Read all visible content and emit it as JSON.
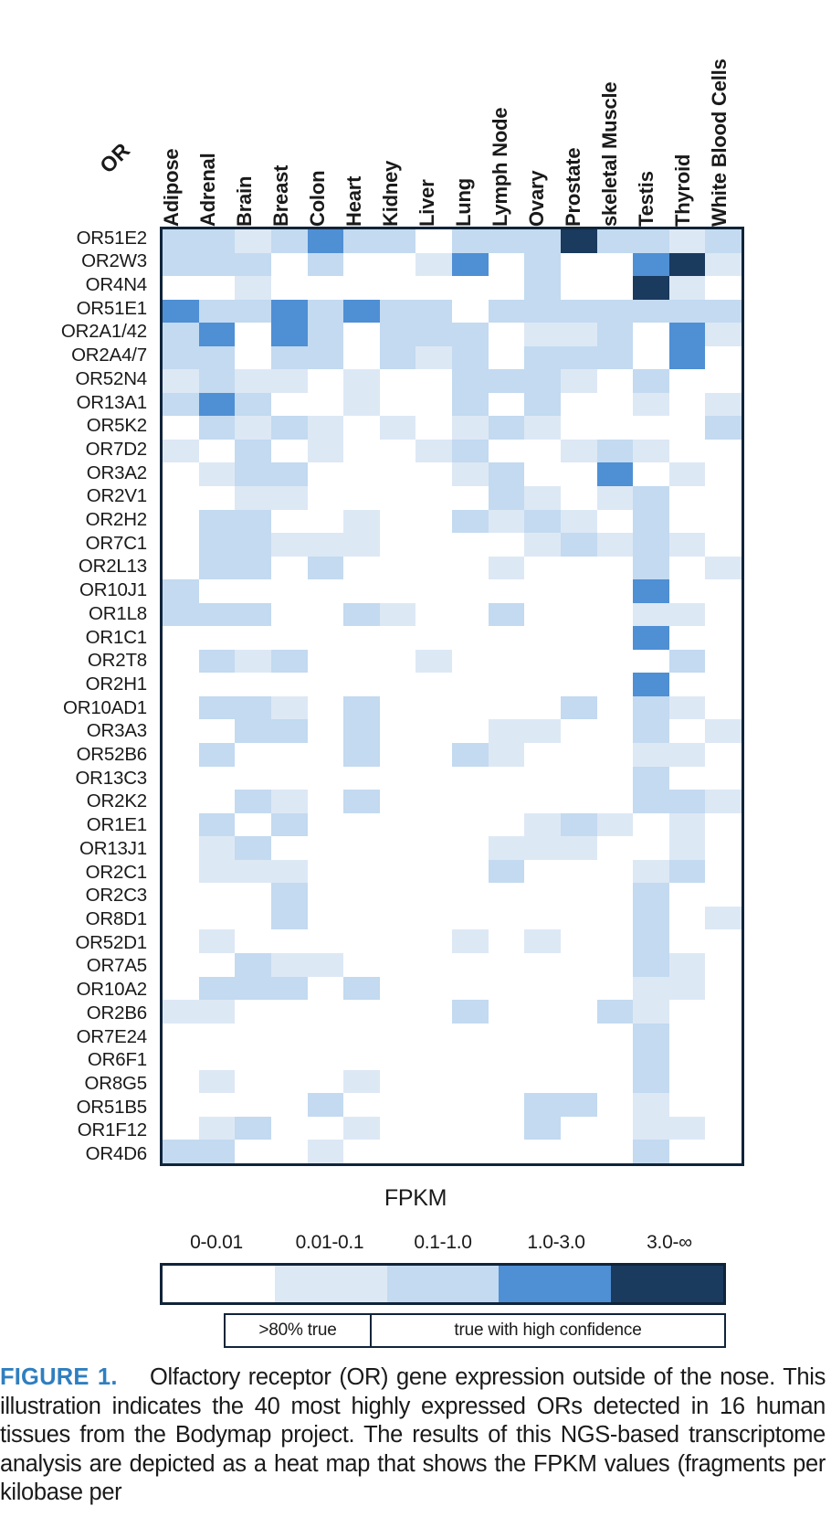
{
  "corner_label": "OR",
  "columns": [
    "Adipose",
    "Adrenal",
    "Brain",
    "Breast",
    "Colon",
    "Heart",
    "Kidney",
    "Liver",
    "Lung",
    "Lymph Node",
    "Ovary",
    "Prostate",
    "skeletal Muscle",
    "Testis",
    "Thyroid",
    "White Blood Cells"
  ],
  "rows": [
    "OR51E2",
    "OR2W3",
    "OR4N4",
    "OR51E1",
    "OR2A1/42",
    "OR2A4/7",
    "OR52N4",
    "OR13A1",
    "OR5K2",
    "OR7D2",
    "OR3A2",
    "OR2V1",
    "OR2H2",
    "OR7C1",
    "OR2L13",
    "OR10J1",
    "OR1L8",
    "OR1C1",
    "OR2T8",
    "OR2H1",
    "OR10AD1",
    "OR3A3",
    "OR52B6",
    "OR13C3",
    "OR2K2",
    "OR1E1",
    "OR13J1",
    "OR2C1",
    "OR2C3",
    "OR8D1",
    "OR52D1",
    "OR7A5",
    "OR10A2",
    "OR2B6",
    "OR7E24",
    "OR6F1",
    "OR8G5",
    "OR51B5",
    "OR1F12",
    "OR4D6"
  ],
  "legend": {
    "title": "FPKM",
    "bins": [
      "0-0.01",
      "0.01-0.1",
      "0.1-1.0",
      "1.0-3.0",
      "3.0-∞"
    ],
    "colors": [
      "#ffffff",
      "#dde8f5",
      "#c3daf0",
      "#4f8fd4",
      "#1a3a5e"
    ],
    "confidence_left": ">80% true",
    "confidence_right": "true with high confidence"
  },
  "caption": {
    "figure_label": "FIGURE 1.",
    "text": "Olfactory receptor (OR) gene expression outside of the nose. This illustration indicates the 40 most highly expressed ORs detected in 16 human tissues from the Bodymap project. The results of this NGS-based transcriptome analysis are depicted as a heat map that shows the FPKM values (fragments per kilobase per"
  },
  "chart_data": {
    "type": "heatmap",
    "title": "Olfactory receptor (OR) gene expression outside of the nose",
    "xlabel": "",
    "ylabel": "OR",
    "colorbar_label": "FPKM",
    "bin_labels": [
      "0-0.01",
      "0.01-0.1",
      "0.1-1.0",
      "1.0-3.0",
      "3.0-∞"
    ],
    "bin_colors": [
      "#ffffff",
      "#dde8f5",
      "#c3daf0",
      "#4f8fd4",
      "#1a3a5e"
    ],
    "x_categories": [
      "Adipose",
      "Adrenal",
      "Brain",
      "Breast",
      "Colon",
      "Heart",
      "Kidney",
      "Liver",
      "Lung",
      "Lymph Node",
      "Ovary",
      "Prostate",
      "skeletal Muscle",
      "Testis",
      "Thyroid",
      "White Blood Cells"
    ],
    "y_categories": [
      "OR51E2",
      "OR2W3",
      "OR4N4",
      "OR51E1",
      "OR2A1/42",
      "OR2A4/7",
      "OR52N4",
      "OR13A1",
      "OR5K2",
      "OR7D2",
      "OR3A2",
      "OR2V1",
      "OR2H2",
      "OR7C1",
      "OR2L13",
      "OR10J1",
      "OR1L8",
      "OR1C1",
      "OR2T8",
      "OR2H1",
      "OR10AD1",
      "OR3A3",
      "OR52B6",
      "OR13C3",
      "OR2K2",
      "OR1E1",
      "OR13J1",
      "OR2C1",
      "OR2C3",
      "OR8D1",
      "OR52D1",
      "OR7A5",
      "OR10A2",
      "OR2B6",
      "OR7E24",
      "OR6F1",
      "OR8G5",
      "OR51B5",
      "OR1F12",
      "OR4D6"
    ],
    "bin_index_note": "values are bin indices 0-4 mapping to bin_labels/bin_colors",
    "values": [
      [
        2,
        2,
        1,
        2,
        3,
        2,
        2,
        0,
        2,
        2,
        2,
        4,
        2,
        2,
        1,
        2
      ],
      [
        2,
        2,
        2,
        0,
        2,
        0,
        0,
        1,
        3,
        0,
        2,
        0,
        0,
        3,
        4,
        1
      ],
      [
        0,
        0,
        1,
        0,
        0,
        0,
        0,
        0,
        0,
        0,
        2,
        0,
        0,
        4,
        1,
        0
      ],
      [
        3,
        2,
        2,
        3,
        2,
        3,
        2,
        2,
        0,
        2,
        2,
        2,
        2,
        2,
        2,
        2
      ],
      [
        2,
        3,
        0,
        3,
        2,
        0,
        2,
        2,
        2,
        0,
        1,
        1,
        2,
        0,
        3,
        1
      ],
      [
        2,
        2,
        0,
        2,
        2,
        0,
        2,
        1,
        2,
        0,
        2,
        2,
        2,
        0,
        3,
        0
      ],
      [
        1,
        2,
        1,
        1,
        0,
        1,
        0,
        0,
        2,
        2,
        2,
        1,
        0,
        2,
        0,
        0
      ],
      [
        2,
        3,
        2,
        0,
        0,
        1,
        0,
        0,
        2,
        0,
        2,
        0,
        0,
        1,
        0,
        1
      ],
      [
        0,
        2,
        1,
        2,
        1,
        0,
        1,
        0,
        1,
        2,
        1,
        0,
        0,
        0,
        0,
        2
      ],
      [
        1,
        0,
        2,
        0,
        1,
        0,
        0,
        1,
        2,
        0,
        0,
        1,
        2,
        1,
        0,
        0
      ],
      [
        0,
        1,
        2,
        2,
        0,
        0,
        0,
        0,
        1,
        2,
        0,
        0,
        3,
        0,
        1,
        0
      ],
      [
        0,
        0,
        1,
        1,
        0,
        0,
        0,
        0,
        0,
        2,
        1,
        0,
        1,
        2,
        0,
        0
      ],
      [
        0,
        2,
        2,
        0,
        0,
        1,
        0,
        0,
        2,
        1,
        2,
        1,
        0,
        2,
        0,
        0
      ],
      [
        0,
        2,
        2,
        1,
        1,
        1,
        0,
        0,
        0,
        0,
        1,
        2,
        1,
        2,
        1,
        0
      ],
      [
        0,
        2,
        2,
        0,
        2,
        0,
        0,
        0,
        0,
        1,
        0,
        0,
        0,
        2,
        0,
        1
      ],
      [
        2,
        0,
        0,
        0,
        0,
        0,
        0,
        0,
        0,
        0,
        0,
        0,
        0,
        3,
        0,
        0
      ],
      [
        2,
        2,
        2,
        0,
        0,
        2,
        1,
        0,
        0,
        2,
        0,
        0,
        0,
        1,
        1,
        0
      ],
      [
        0,
        0,
        0,
        0,
        0,
        0,
        0,
        0,
        0,
        0,
        0,
        0,
        0,
        3,
        0,
        0
      ],
      [
        0,
        2,
        1,
        2,
        0,
        0,
        0,
        1,
        0,
        0,
        0,
        0,
        0,
        0,
        2,
        0
      ],
      [
        0,
        0,
        0,
        0,
        0,
        0,
        0,
        0,
        0,
        0,
        0,
        0,
        0,
        3,
        0,
        0
      ],
      [
        0,
        2,
        2,
        1,
        0,
        2,
        0,
        0,
        0,
        0,
        0,
        2,
        0,
        2,
        1,
        0
      ],
      [
        0,
        0,
        2,
        2,
        0,
        2,
        0,
        0,
        0,
        1,
        1,
        0,
        0,
        2,
        0,
        1
      ],
      [
        0,
        2,
        0,
        0,
        0,
        2,
        0,
        0,
        2,
        1,
        0,
        0,
        0,
        1,
        1,
        0
      ],
      [
        0,
        0,
        0,
        0,
        0,
        0,
        0,
        0,
        0,
        0,
        0,
        0,
        0,
        2,
        0,
        0
      ],
      [
        0,
        0,
        2,
        1,
        0,
        2,
        0,
        0,
        0,
        0,
        0,
        0,
        0,
        2,
        2,
        1
      ],
      [
        0,
        2,
        0,
        2,
        0,
        0,
        0,
        0,
        0,
        0,
        1,
        2,
        1,
        0,
        1,
        0
      ],
      [
        0,
        1,
        2,
        0,
        0,
        0,
        0,
        0,
        0,
        1,
        1,
        1,
        0,
        0,
        1,
        0
      ],
      [
        0,
        1,
        1,
        1,
        0,
        0,
        0,
        0,
        0,
        2,
        0,
        0,
        0,
        1,
        2,
        0
      ],
      [
        0,
        0,
        0,
        2,
        0,
        0,
        0,
        0,
        0,
        0,
        0,
        0,
        0,
        2,
        0,
        0
      ],
      [
        0,
        0,
        0,
        2,
        0,
        0,
        0,
        0,
        0,
        0,
        0,
        0,
        0,
        2,
        0,
        1
      ],
      [
        0,
        1,
        0,
        0,
        0,
        0,
        0,
        0,
        1,
        0,
        1,
        0,
        0,
        2,
        0,
        0
      ],
      [
        0,
        0,
        2,
        1,
        1,
        0,
        0,
        0,
        0,
        0,
        0,
        0,
        0,
        2,
        1,
        0
      ],
      [
        0,
        2,
        2,
        2,
        0,
        2,
        0,
        0,
        0,
        0,
        0,
        0,
        0,
        1,
        1,
        0
      ],
      [
        1,
        1,
        0,
        0,
        0,
        0,
        0,
        0,
        2,
        0,
        0,
        0,
        2,
        1,
        0,
        0
      ],
      [
        0,
        0,
        0,
        0,
        0,
        0,
        0,
        0,
        0,
        0,
        0,
        0,
        0,
        2,
        0,
        0
      ],
      [
        0,
        0,
        0,
        0,
        0,
        0,
        0,
        0,
        0,
        0,
        0,
        0,
        0,
        2,
        0,
        0
      ],
      [
        0,
        1,
        0,
        0,
        0,
        1,
        0,
        0,
        0,
        0,
        0,
        0,
        0,
        2,
        0,
        0
      ],
      [
        0,
        0,
        0,
        0,
        2,
        0,
        0,
        0,
        0,
        0,
        2,
        2,
        0,
        1,
        0,
        0
      ],
      [
        0,
        1,
        2,
        0,
        0,
        1,
        0,
        0,
        0,
        0,
        2,
        0,
        0,
        1,
        1,
        0
      ],
      [
        2,
        2,
        0,
        0,
        1,
        0,
        0,
        0,
        0,
        0,
        0,
        0,
        0,
        2,
        0,
        0
      ]
    ]
  }
}
